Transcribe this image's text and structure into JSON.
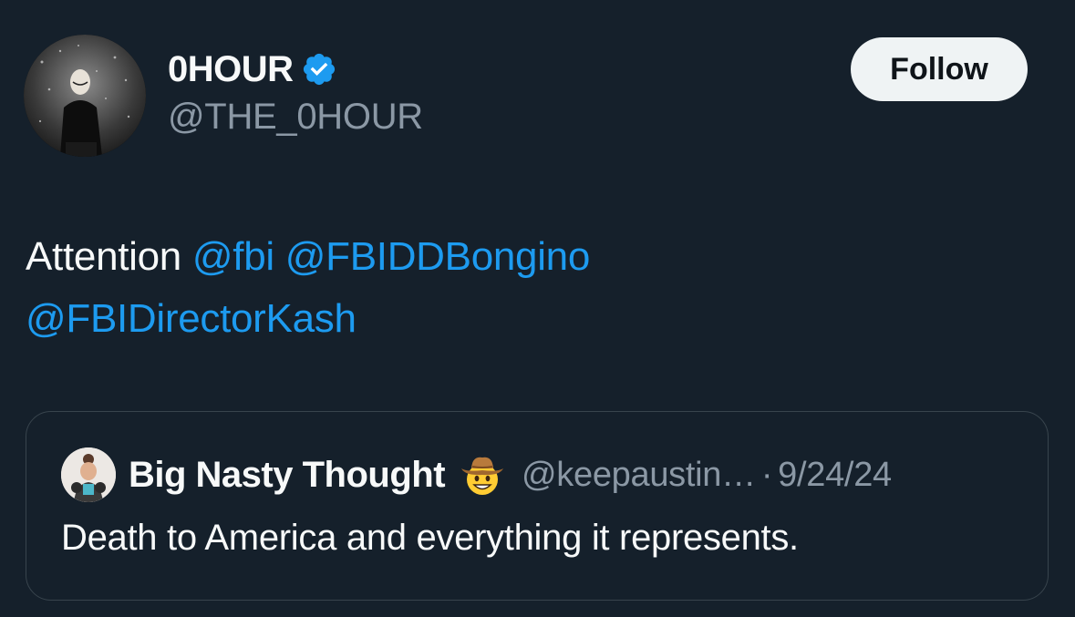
{
  "author": {
    "display_name": "0HOUR",
    "handle": "@THE_0HOUR",
    "verified": true
  },
  "follow_label": "Follow",
  "tweet": {
    "text_prefix": "Attention ",
    "mentions": [
      "@fbi",
      "@FBIDDBongino",
      "@FBIDirectorKash"
    ]
  },
  "quote": {
    "display_name": "Big Nasty Thought",
    "emoji": "cowboy-hat-face",
    "handle": "@keepaustin…",
    "separator": "·",
    "date": "9/24/24",
    "text": "Death to America and everything it represents."
  },
  "colors": {
    "background": "#15202b",
    "link": "#1d9bf0",
    "muted": "#8b98a5",
    "verified": "#1d9bf0",
    "border": "#38444d"
  }
}
